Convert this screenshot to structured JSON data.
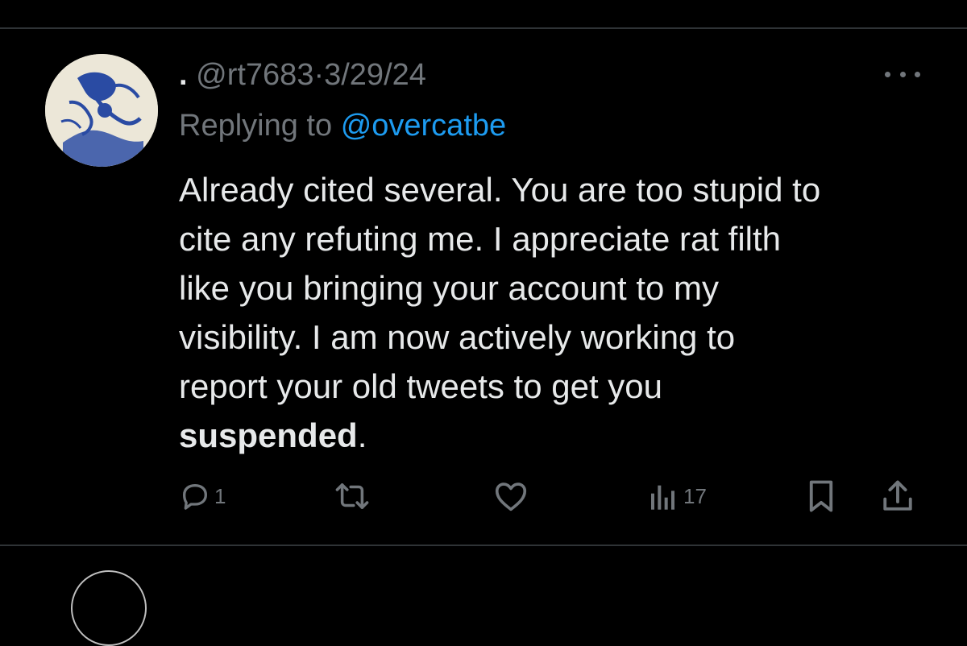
{
  "tweet": {
    "display_name": ".",
    "handle": "@rt7683",
    "separator": "·",
    "date": "3/29/24",
    "replying_prefix": "Replying to",
    "replying_to": "@overcatbe",
    "body_lines": [
      "Already cited several. You are too stupid to",
      "cite any refuting me. I appreciate rat filth",
      "like you bringing your account to my",
      "visibility. I am now actively working to",
      "report your old tweets to get you"
    ],
    "body_bold": "suspended",
    "body_end": ".",
    "actions": {
      "reply_count": "1",
      "views_count": "17"
    },
    "icons": {
      "more": "more-icon",
      "reply": "reply-icon",
      "retweet": "retweet-icon",
      "like": "heart-icon",
      "views": "views-icon",
      "bookmark": "bookmark-icon",
      "share": "share-icon"
    }
  },
  "colors": {
    "background": "#000000",
    "text": "#e7e9ea",
    "muted": "#71767b",
    "link": "#1d9bf0",
    "divider": "#2f3336"
  }
}
